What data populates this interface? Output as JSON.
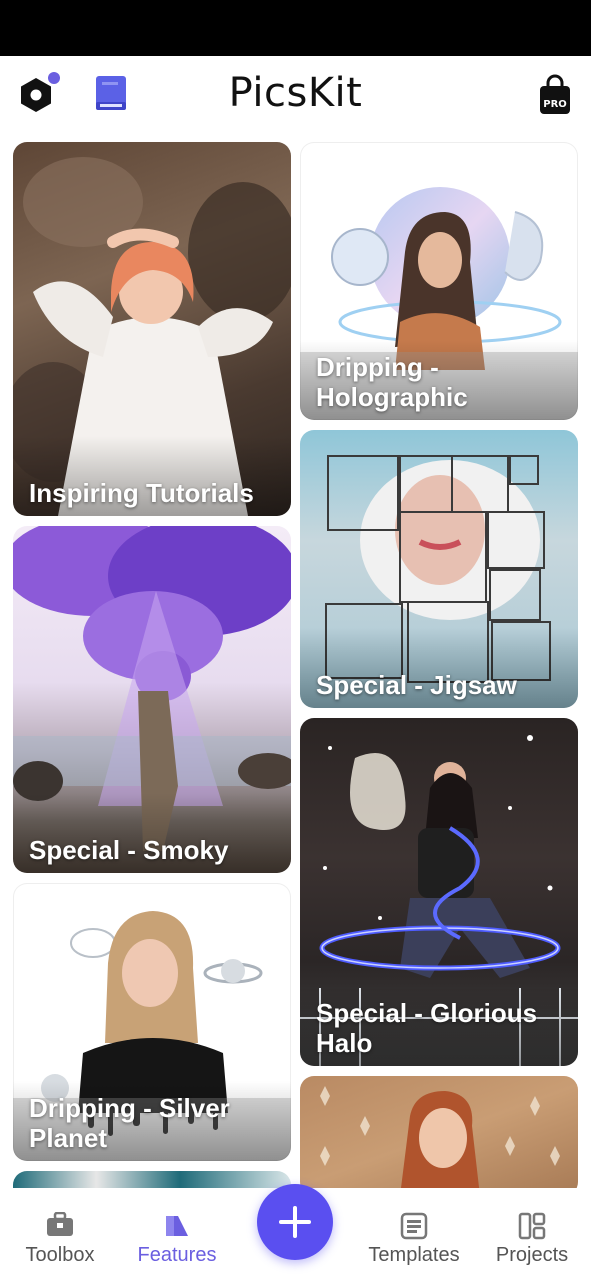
{
  "header": {
    "title": "PicsKit",
    "pro_badge": "PRO",
    "notification_dot_color": "#6b5fe0",
    "book_icon_color": "#5b61e6"
  },
  "feed": {
    "cards": [
      {
        "label": "Inspiring Tutorials"
      },
      {
        "label": "Dripping - Holographic"
      },
      {
        "label": "Special - Jigsaw"
      },
      {
        "label": "Special - Smoky"
      },
      {
        "label": "Special - Glorious Halo"
      },
      {
        "label": "Dripping - Silver Planet"
      }
    ]
  },
  "bottom_nav": {
    "items": [
      {
        "label": "Toolbox",
        "icon": "toolbox-icon"
      },
      {
        "label": "Features",
        "icon": "features-icon",
        "active": true
      },
      {
        "label": "Templates",
        "icon": "templates-icon"
      },
      {
        "label": "Projects",
        "icon": "projects-icon"
      }
    ],
    "active_color": "#6b5fe0",
    "fab_color": "#5a4ff0"
  }
}
